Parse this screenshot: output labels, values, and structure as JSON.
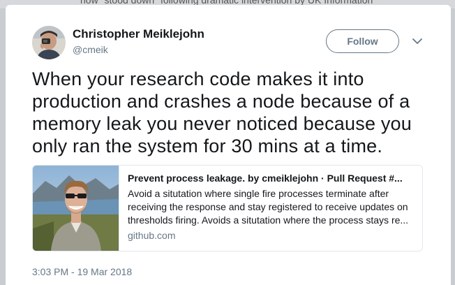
{
  "background": {
    "clipped_text": "now \"stood down\" following dramatic intervention by UK Information"
  },
  "tweet": {
    "author_name": "Christopher Meiklejohn",
    "author_handle": "@cmeik",
    "follow_label": "Follow",
    "text": "When your research code makes it into production and crashes a node because of a memory leak you never noticed because you only ran the system for 30 mins at a time.",
    "timestamp": "3:03 PM - 19 Mar 2018"
  },
  "link_card": {
    "title": "Prevent process leakage. by cmeiklejohn · Pull Request #...",
    "description_lines": [
      "Avoid a situtation where single fire processes terminate after",
      "receiving the response and stay registered to receive updates on",
      "thresholds firing. Avoids a situtation where the process stays re..."
    ],
    "domain": "github.com"
  },
  "icons": {
    "caret": "chevron-down-icon",
    "avatar": "avatar-photo",
    "thumbnail": "link-thumbnail-photo"
  },
  "colors": {
    "text_primary": "#14171a",
    "text_secondary": "#657786",
    "border": "#e1e8ed"
  }
}
